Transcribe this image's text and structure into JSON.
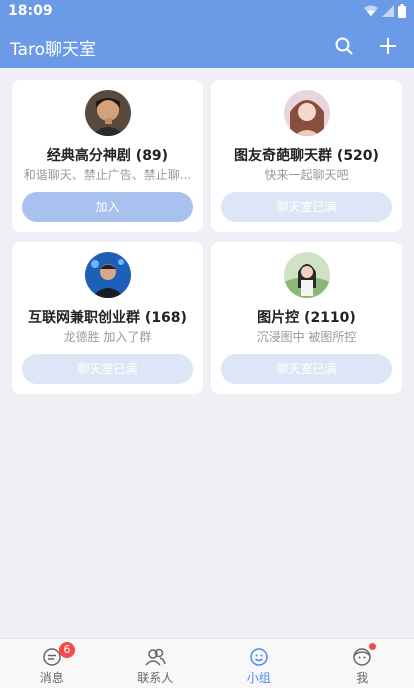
{
  "status_bar": {
    "time": "18:09"
  },
  "app": {
    "title": "Taro聊天室"
  },
  "groups": [
    {
      "name": "经典高分神剧 (89)",
      "desc": "和谐聊天、禁止广告、禁止聊...",
      "button": "加入",
      "state": "join"
    },
    {
      "name": "图友奇葩聊天群 (520)",
      "desc": "快来一起聊天吧",
      "button": "聊天室已满",
      "state": "full"
    },
    {
      "name": "互联网兼职创业群 (168)",
      "desc": "龙德胜 加入了群",
      "button": "聊天室已满",
      "state": "full"
    },
    {
      "name": "图片控 (2110)",
      "desc": "沉浸图中 被图所控",
      "button": "聊天室已满",
      "state": "full"
    }
  ],
  "tabbar": {
    "items": [
      {
        "label": "消息",
        "badge": "6"
      },
      {
        "label": "联系人"
      },
      {
        "label": "小组",
        "active": true
      },
      {
        "label": "我",
        "dot": true
      }
    ]
  },
  "colors": {
    "header": "#6b9ae6",
    "active_tab": "#4a8cf0",
    "badge": "#f24b4b",
    "join_button": "#a9c1ef",
    "full_button": "#dde6f6"
  }
}
